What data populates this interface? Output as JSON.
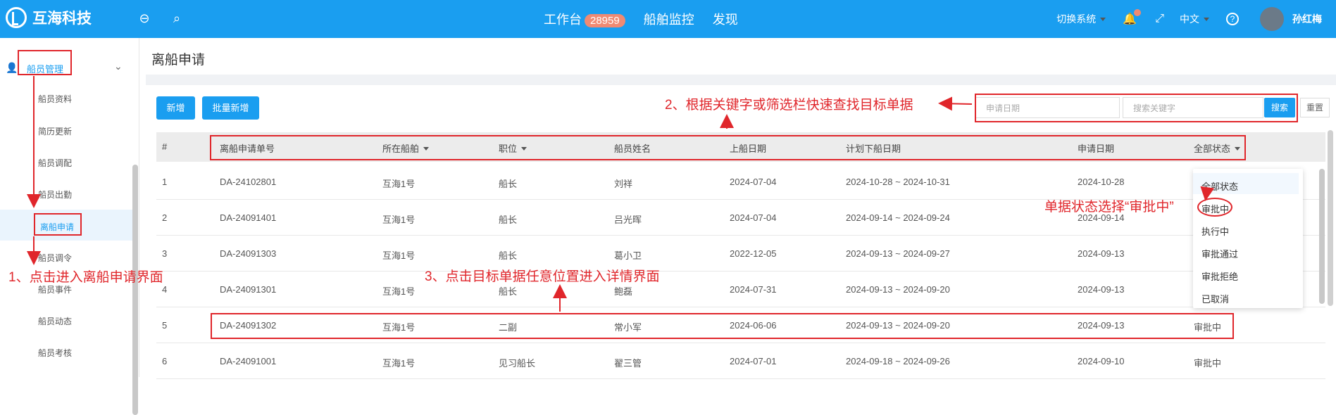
{
  "app": {
    "name": "互海科技"
  },
  "topnav": {
    "workbench": "工作台",
    "workbench_count": "28959",
    "monitor": "船舶监控",
    "discover": "发现"
  },
  "topright": {
    "switch_system": "切换系统",
    "language": "中文",
    "user": "孙红梅"
  },
  "sidebar": {
    "group": "船员管理",
    "items": [
      "船员资料",
      "简历更新",
      "船员调配",
      "船员出勤",
      "离船申请",
      "船员调令",
      "船员事件",
      "船员动态",
      "船员考核"
    ],
    "active": "离船申请"
  },
  "page": {
    "title": "离船申请"
  },
  "toolbar": {
    "add": "新增",
    "batch_add": "批量新增",
    "date_placeholder": "申请日期",
    "search_placeholder": "搜索关键字",
    "search": "搜索",
    "reset": "重置"
  },
  "table": {
    "headers": [
      "#",
      "离船申请单号",
      "所在船舶",
      "职位",
      "船员姓名",
      "上船日期",
      "计划下船日期",
      "申请日期",
      "全部状态"
    ],
    "rows": [
      [
        "1",
        "DA-24102801",
        "互海1号",
        "船长",
        "刘祥",
        "2024-07-04",
        "2024-10-28 ~ 2024-10-31",
        "2024-10-28",
        ""
      ],
      [
        "2",
        "DA-24091401",
        "互海1号",
        "船长",
        "吕光晖",
        "2024-07-04",
        "2024-09-14 ~ 2024-09-24",
        "2024-09-14",
        ""
      ],
      [
        "3",
        "DA-24091303",
        "互海1号",
        "船长",
        "葛小卫",
        "2022-12-05",
        "2024-09-13 ~ 2024-09-27",
        "2024-09-13",
        ""
      ],
      [
        "4",
        "DA-24091301",
        "互海1号",
        "船长",
        "鲍磊",
        "2024-07-31",
        "2024-09-13 ~ 2024-09-20",
        "2024-09-13",
        ""
      ],
      [
        "5",
        "DA-24091302",
        "互海1号",
        "二副",
        "常小军",
        "2024-06-06",
        "2024-09-13 ~ 2024-09-20",
        "2024-09-13",
        "审批中"
      ],
      [
        "6",
        "DA-24091001",
        "互海1号",
        "见习船长",
        "翟三管",
        "2024-07-01",
        "2024-09-18 ~ 2024-09-26",
        "2024-09-10",
        "审批中"
      ]
    ]
  },
  "status_dropdown": {
    "options": [
      "全部状态",
      "审批中",
      "执行中",
      "审批通过",
      "审批拒绝",
      "已取消"
    ]
  },
  "annotations": {
    "step1": "1、点击进入离船申请界面",
    "step2": "2、根据关键字或筛选栏快速查找目标单据",
    "step3": "3、点击目标单据任意位置进入详情界面",
    "status_tip": "单据状态选择“审批中”"
  },
  "colors": {
    "brand": "#1a9ef0",
    "annotation": "#e0262b",
    "badge": "#f08a73"
  }
}
